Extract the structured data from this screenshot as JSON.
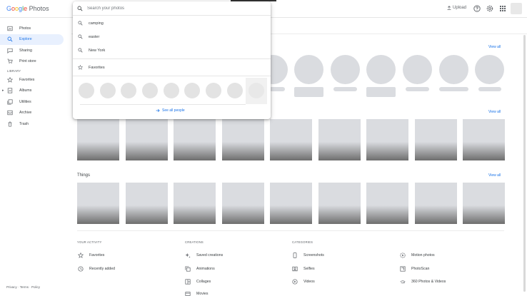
{
  "header": {
    "logo_google": [
      "G",
      "o",
      "o",
      "g",
      "l",
      "e"
    ],
    "logo_product": "Photos",
    "upload_label": "Upload",
    "help_icon": "help-icon",
    "settings_icon": "gear-icon",
    "apps_icon": "apps-grid-icon"
  },
  "sidebar": {
    "items": [
      {
        "label": "Photos",
        "icon": "photo-icon",
        "active": false
      },
      {
        "label": "Explore",
        "icon": "search-icon",
        "active": true
      },
      {
        "label": "Sharing",
        "icon": "chat-icon",
        "active": false
      },
      {
        "label": "Print store",
        "icon": "cart-icon",
        "active": false
      }
    ],
    "library_heading": "LIBRARY",
    "library_items": [
      {
        "label": "Favorites",
        "icon": "star-icon"
      },
      {
        "label": "Albums",
        "icon": "album-icon"
      },
      {
        "label": "Utilities",
        "icon": "utilities-icon"
      },
      {
        "label": "Archive",
        "icon": "archive-icon"
      },
      {
        "label": "Trash",
        "icon": "trash-icon"
      }
    ],
    "footer": {
      "privacy": "Privacy",
      "terms": "Terms",
      "policy": "Policy",
      "dot": "·"
    }
  },
  "search": {
    "placeholder": "Search your photos",
    "suggestions": [
      "camping",
      "easter",
      "New York"
    ],
    "favorites_label": "Favorites",
    "see_all_people": "See all people"
  },
  "main": {
    "view_all": "View all",
    "things_title": "Things",
    "your_activity_heading": "YOUR ACTIVITY",
    "creations_heading": "CREATIONS",
    "categories_heading": "CATEGORIES",
    "your_activity": [
      {
        "label": "Favorites",
        "icon": "star-icon"
      },
      {
        "label": "Recently added",
        "icon": "clock-icon"
      }
    ],
    "creations": [
      {
        "label": "Saved creations",
        "icon": "sparkle-icon"
      },
      {
        "label": "Animations",
        "icon": "animation-icon"
      },
      {
        "label": "Collages",
        "icon": "collage-icon"
      },
      {
        "label": "Movies",
        "icon": "movie-icon"
      }
    ],
    "categories": [
      {
        "label": "Screenshots",
        "icon": "phone-icon"
      },
      {
        "label": "Selfies",
        "icon": "selfie-icon"
      },
      {
        "label": "Videos",
        "icon": "play-icon"
      }
    ],
    "categories_right": [
      {
        "label": "Motion photos",
        "icon": "motion-icon"
      },
      {
        "label": "PhotoScan",
        "icon": "photoscan-icon"
      },
      {
        "label": "360 Photos & Videos",
        "icon": "panorama-icon"
      }
    ]
  },
  "colors": {
    "accent": "#1a73e8",
    "active_bg": "#e8f0fe",
    "placeholder_gray": "#dadce0"
  }
}
